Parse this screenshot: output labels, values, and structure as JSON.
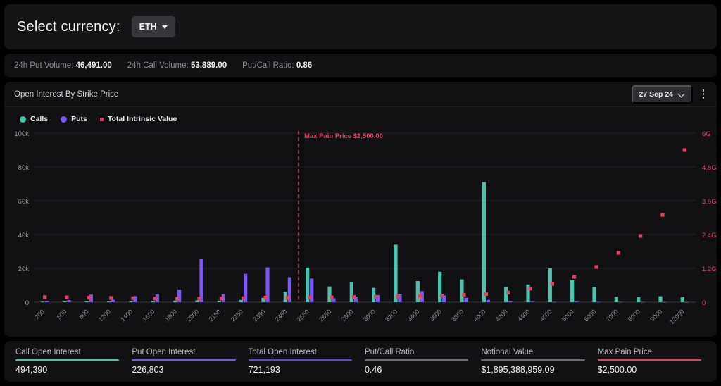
{
  "currency": {
    "label": "Select currency:",
    "selected": "ETH"
  },
  "volume": {
    "put_label": "24h Put Volume:",
    "put_value": "46,491.00",
    "call_label": "24h Call Volume:",
    "call_value": "53,889.00",
    "ratio_label": "Put/Call Ratio:",
    "ratio_value": "0.86"
  },
  "chart_header": {
    "title": "Open Interest By Strike Price",
    "date": "27 Sep 24"
  },
  "colors": {
    "calls": "#4ac4ae",
    "puts": "#7b55f0",
    "intrinsic": "#e8405c",
    "total_oi": "#5b4bd6",
    "neutral": "#6b6b72",
    "grid": "#242428",
    "background": "#111113"
  },
  "chart_data": {
    "type": "bar",
    "title": "Open Interest By Strike Price",
    "xlabel": "",
    "ylabel": "Open Interest",
    "y2label": "Total Intrinsic Value",
    "ylim": [
      0,
      100000
    ],
    "y2lim": [
      0,
      6000000000
    ],
    "yticks": [
      0,
      20000,
      40000,
      60000,
      80000,
      100000
    ],
    "ytick_labels": [
      "0",
      "20k",
      "40k",
      "60k",
      "80k",
      "100k"
    ],
    "y2ticks": [
      0,
      1200000000,
      2400000000,
      3600000000,
      4800000000,
      6000000000
    ],
    "y2tick_labels": [
      "0",
      "1.2G",
      "2.4G",
      "3.6G",
      "4.8G",
      "6G"
    ],
    "grid": true,
    "legend": [
      {
        "name": "Calls",
        "color": "#4ac4ae",
        "marker": "circle"
      },
      {
        "name": "Puts",
        "color": "#7b55f0",
        "marker": "circle"
      },
      {
        "name": "Total Intrinsic Value",
        "color": "#e8405c",
        "marker": "square"
      }
    ],
    "annotation": {
      "text": "Max Pain Price $2,500.00",
      "x_category": "2550",
      "color": "#e8405c",
      "style": "dashed-vline"
    },
    "categories": [
      "200",
      "500",
      "800",
      "1200",
      "1400",
      "1600",
      "1800",
      "2000",
      "2150",
      "2250",
      "2350",
      "2450",
      "2550",
      "2650",
      "2800",
      "3000",
      "3200",
      "3400",
      "3600",
      "3800",
      "4000",
      "4200",
      "4400",
      "4600",
      "5000",
      "6000",
      "7000",
      "8000",
      "9000",
      "12000"
    ],
    "series": [
      {
        "name": "Calls",
        "color": "#4ac4ae",
        "axis": "left",
        "values": [
          300,
          400,
          500,
          400,
          600,
          700,
          900,
          1100,
          900,
          1300,
          2600,
          6200,
          20500,
          9300,
          12000,
          8500,
          34000,
          12500,
          18000,
          13500,
          71000,
          8900,
          10500,
          20000,
          13000,
          9000,
          3200,
          3000,
          3500,
          3000
        ]
      },
      {
        "name": "Puts",
        "color": "#7b55f0",
        "axis": "left",
        "values": [
          800,
          1200,
          4500,
          1400,
          3600,
          4600,
          7400,
          25400,
          4800,
          16800,
          20600,
          14800,
          14000,
          2300,
          3200,
          4200,
          5000,
          6500,
          4000,
          2600,
          1400,
          500,
          300,
          200,
          400,
          200,
          150,
          120,
          100,
          80
        ]
      },
      {
        "name": "Total Intrinsic Value",
        "color": "#e8405c",
        "axis": "right",
        "marker": "square",
        "values": [
          180000000,
          170000000,
          160000000,
          150000000,
          140000000,
          130000000,
          120000000,
          125000000,
          130000000,
          140000000,
          160000000,
          150000000,
          160000000,
          170000000,
          185000000,
          190000000,
          200000000,
          215000000,
          235000000,
          260000000,
          290000000,
          340000000,
          480000000,
          650000000,
          900000000,
          1250000000,
          1750000000,
          2350000000,
          3100000000,
          5400000000
        ]
      }
    ]
  },
  "stats": [
    {
      "label": "Call Open Interest",
      "value": "494,390",
      "rule_color": "#4ac4ae"
    },
    {
      "label": "Put Open Interest",
      "value": "226,803",
      "rule_color": "#7b55f0"
    },
    {
      "label": "Total Open Interest",
      "value": "721,193",
      "rule_color": "#5b4bd6"
    },
    {
      "label": "Put/Call Ratio",
      "value": "0.46",
      "rule_color": "#6b6b72"
    },
    {
      "label": "Notional Value",
      "value": "$1,895,388,959.09",
      "rule_color": "#6b6b72"
    },
    {
      "label": "Max Pain Price",
      "value": "$2,500.00",
      "rule_color": "#e8405c"
    }
  ]
}
